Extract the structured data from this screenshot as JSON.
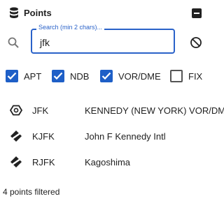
{
  "header": {
    "title": "Points",
    "icon": "database-icon"
  },
  "search": {
    "label": "Search (min 2 chars)...",
    "value": "jfk",
    "accent": "#2a62c9"
  },
  "filters": [
    {
      "label": "APT",
      "checked": true
    },
    {
      "label": "NDB",
      "checked": true
    },
    {
      "label": "VOR/DME",
      "checked": true
    },
    {
      "label": "FIX",
      "checked": false
    }
  ],
  "results": [
    {
      "ident": "JFK",
      "name": "KENNEDY (NEW YORK) VOR/DME",
      "icon": "vor-dme-icon"
    },
    {
      "ident": "KJFK",
      "name": "John F Kennedy Intl",
      "icon": "airport-icon"
    },
    {
      "ident": "RJFK",
      "name": "Kagoshima",
      "icon": "airport-icon"
    }
  ],
  "status": "4 points filtered"
}
